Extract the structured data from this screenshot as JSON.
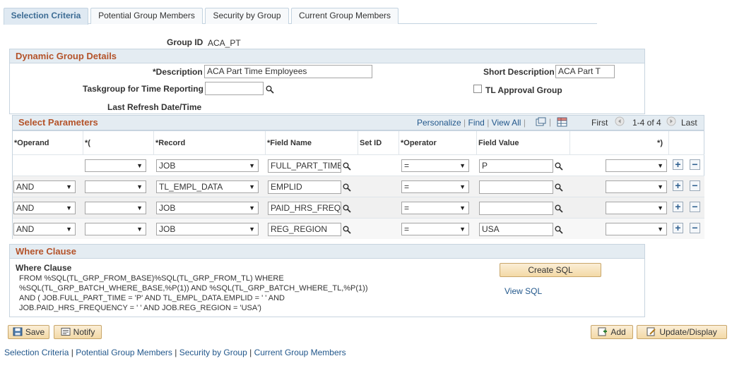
{
  "tabs": [
    {
      "label": "Selection Criteria",
      "active": true
    },
    {
      "label": "Potential Group Members"
    },
    {
      "label": "Security by Group"
    },
    {
      "label": "Current Group Members"
    }
  ],
  "group_id": {
    "label": "Group ID",
    "value": "ACA_PT"
  },
  "dynamic": {
    "title": "Dynamic Group Details",
    "description_label": "*Description",
    "description_value": "ACA Part Time Employees",
    "short_desc_label": "Short Description",
    "short_desc_value": "ACA Part T",
    "taskgroup_label": "Taskgroup for Time Reporting",
    "taskgroup_value": "",
    "tl_approval_label": "TL Approval Group",
    "last_refresh_label": "Last Refresh Date/Time"
  },
  "params": {
    "title": "Select Parameters",
    "personalize": "Personalize",
    "find": "Find",
    "view_all": "View All",
    "first": "First",
    "range": "1-4 of 4",
    "last": "Last",
    "columns": [
      "*Operand",
      "*(",
      "*Record",
      "*Field Name",
      "Set ID",
      "*Operator",
      "Field Value",
      "*)"
    ],
    "rows": [
      {
        "operand": "",
        "open_paren": "",
        "record": "JOB",
        "field_name": "FULL_PART_TIME",
        "operator": "=",
        "field_value": "P",
        "close_paren": ""
      },
      {
        "operand": "AND",
        "open_paren": "",
        "record": "TL_EMPL_DATA",
        "field_name": "EMPLID",
        "operator": "=",
        "field_value": "",
        "close_paren": ""
      },
      {
        "operand": "AND",
        "open_paren": "",
        "record": "JOB",
        "field_name": "PAID_HRS_FREQ",
        "operator": "=",
        "field_value": "",
        "close_paren": ""
      },
      {
        "operand": "AND",
        "open_paren": "",
        "record": "JOB",
        "field_name": "REG_REGION",
        "operator": "=",
        "field_value": "USA",
        "close_paren": ""
      }
    ]
  },
  "where": {
    "title": "Where Clause",
    "label": "Where Clause",
    "lines": [
      "FROM  %SQL(TL_GRP_FROM_BASE)%SQL(TL_GRP_FROM_TL) WHERE",
      "%SQL(TL_GRP_BATCH_WHERE_BASE,%P(1)) AND %SQL(TL_GRP_BATCH_WHERE_TL,%P(1))",
      "AND ( JOB.FULL_PART_TIME = 'P' AND TL_EMPL_DATA.EMPLID = ' ' AND",
      "JOB.PAID_HRS_FREQUENCY = ' ' AND JOB.REG_REGION = 'USA')"
    ],
    "create_sql": "Create SQL",
    "view_sql": "View SQL"
  },
  "toolbar": {
    "save": "Save",
    "notify": "Notify",
    "add": "Add",
    "update_display": "Update/Display"
  },
  "footer_links": [
    "Selection Criteria",
    "Potential Group Members",
    "Security by Group",
    "Current Group Members"
  ],
  "colors": {
    "header_text": "#b4532a",
    "link": "#23588c",
    "tab_active": "#3d6c94"
  }
}
